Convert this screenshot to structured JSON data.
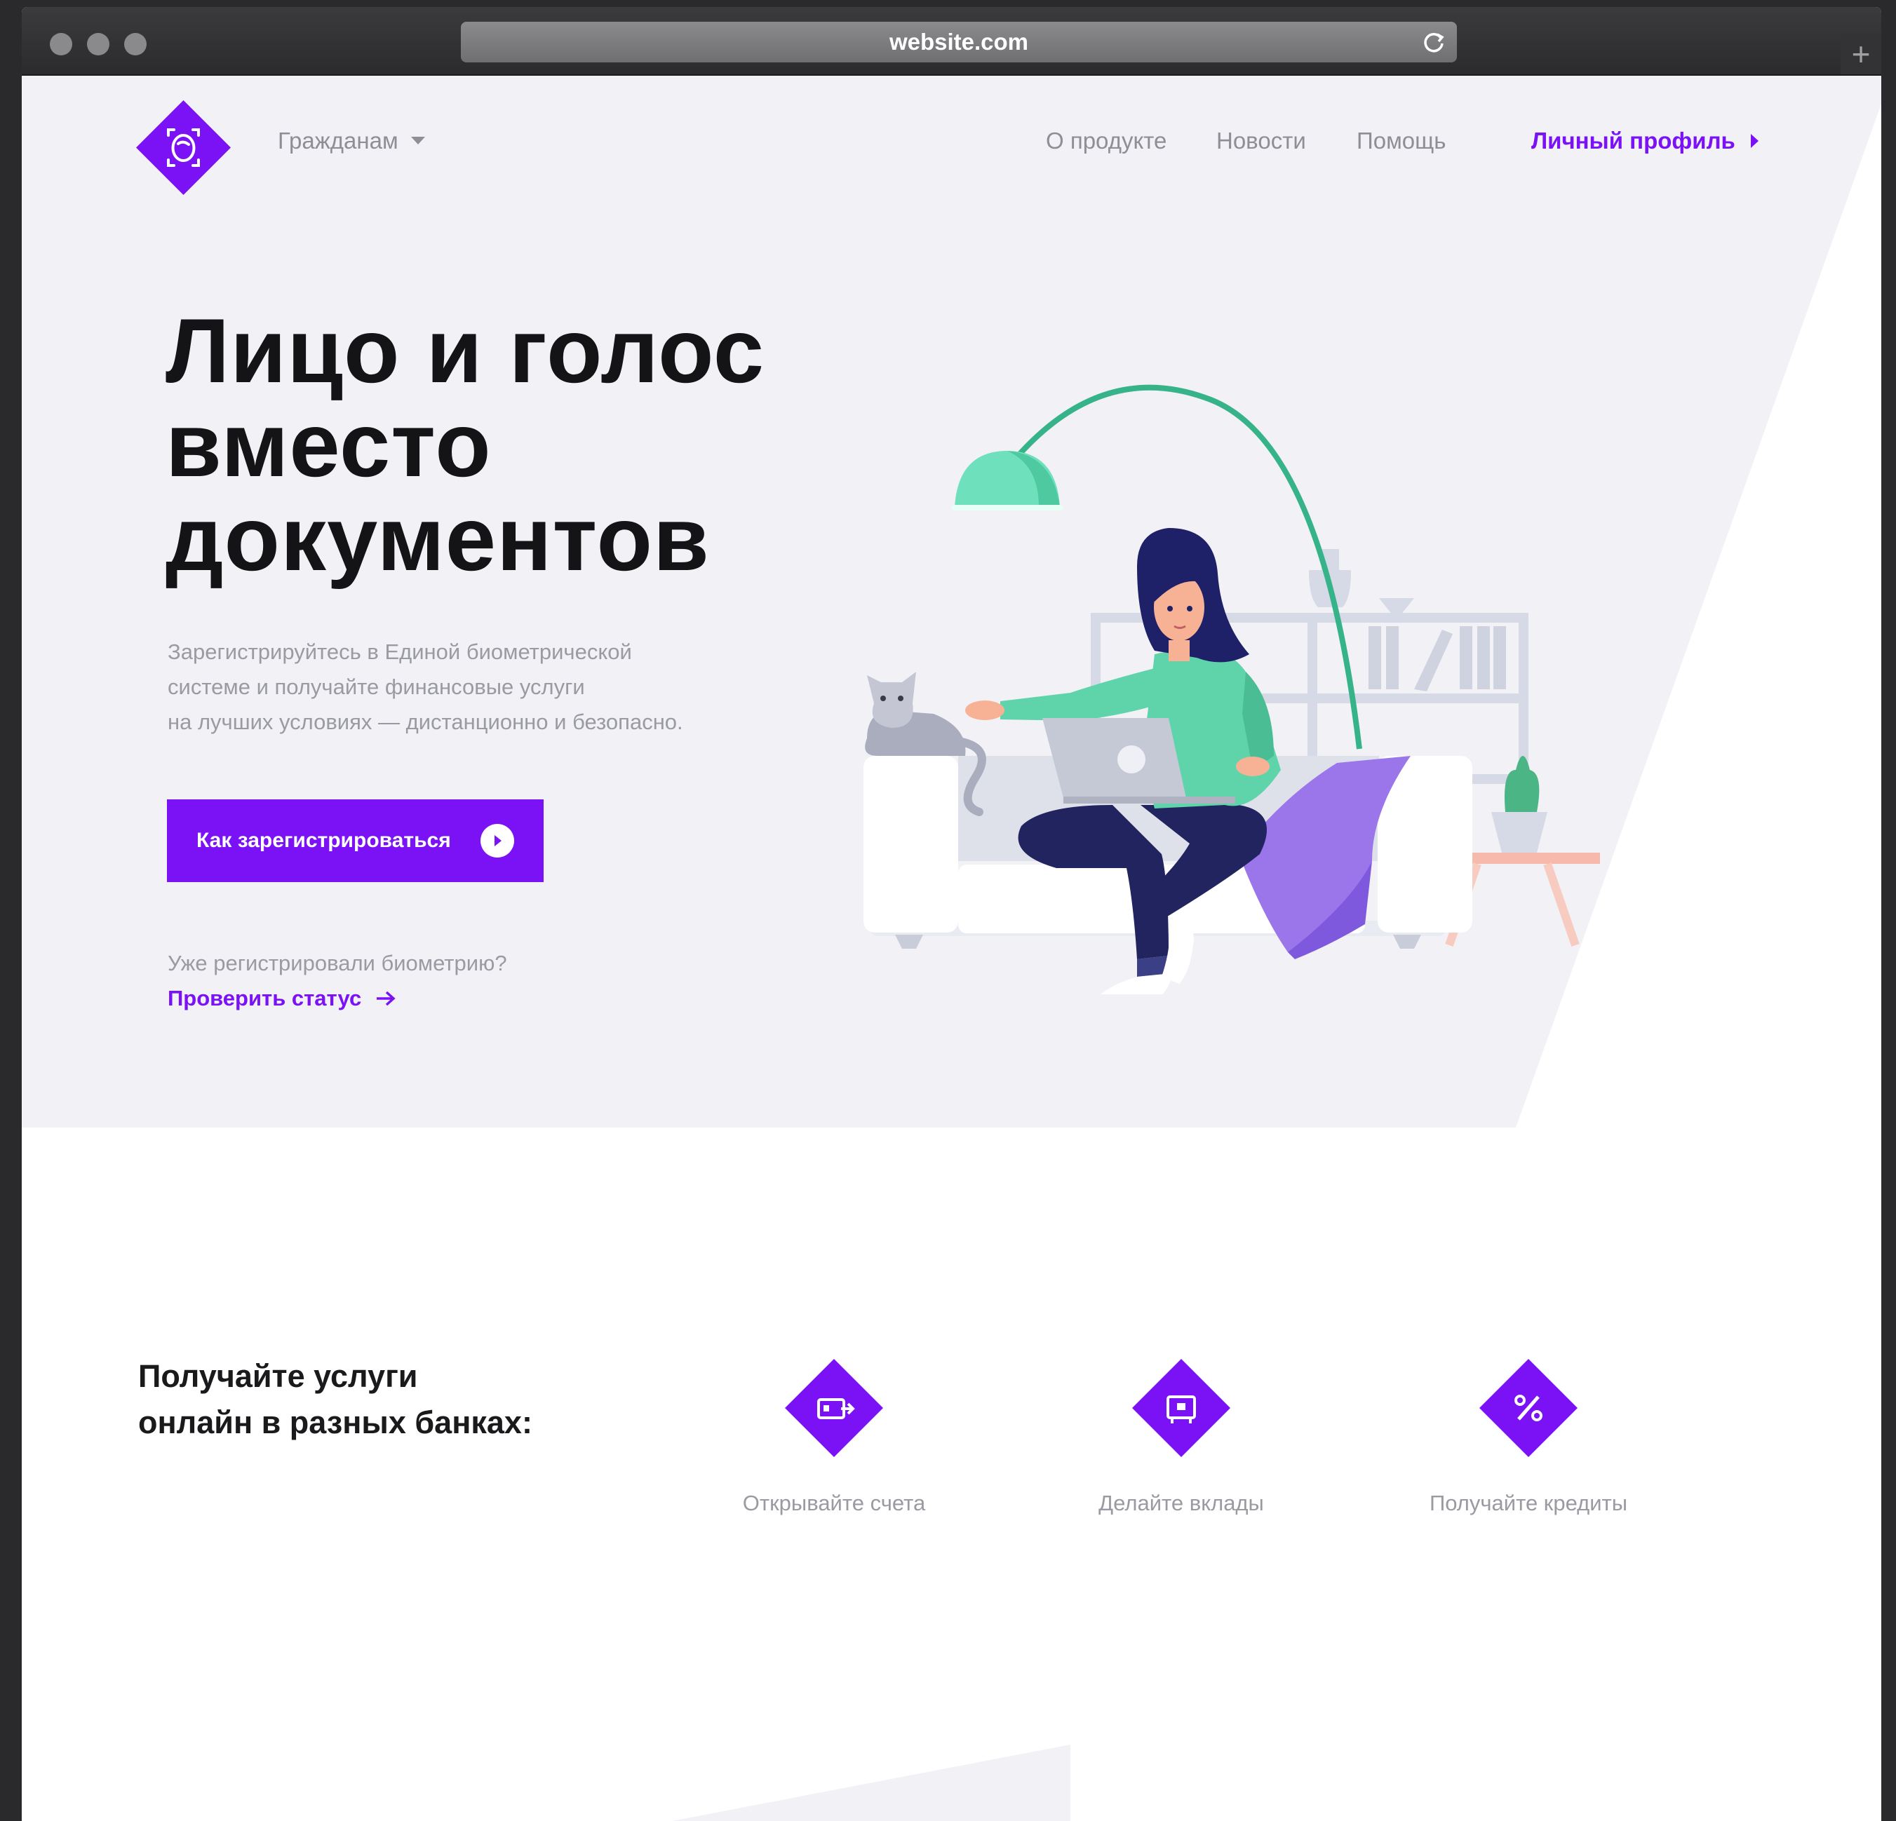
{
  "browser": {
    "url": "website.com",
    "new_tab_label": "+"
  },
  "nav": {
    "dropdown_label": "Гражданам",
    "links": [
      "О продукте",
      "Новости",
      "Помощь"
    ],
    "profile_label": "Личный профиль"
  },
  "hero": {
    "title": "Лицо и голос\nвместо\nдокументов",
    "description": "Зарегистрируйтесь в Единой биометрической\nсистеме и получайте финансовые услуги\nна лучших условиях — дистанционно и безопасно.",
    "cta_label": "Как зарегистрироваться",
    "already_text": "Уже регистрировали биометрию?",
    "check_status_label": "Проверить статус"
  },
  "services": {
    "title": "Получайте услуги\nонлайн в разных банках:",
    "items": [
      {
        "label": "Открывайте счета",
        "icon": "card-transfer-icon"
      },
      {
        "label": "Делайте вклады",
        "icon": "safe-icon"
      },
      {
        "label": "Получайте кредиты",
        "icon": "percent-icon"
      }
    ]
  },
  "colors": {
    "accent": "#7b11f5",
    "hero_bg": "#f1f1f6",
    "text_dark": "#141416",
    "text_muted": "#9a9aa2"
  }
}
